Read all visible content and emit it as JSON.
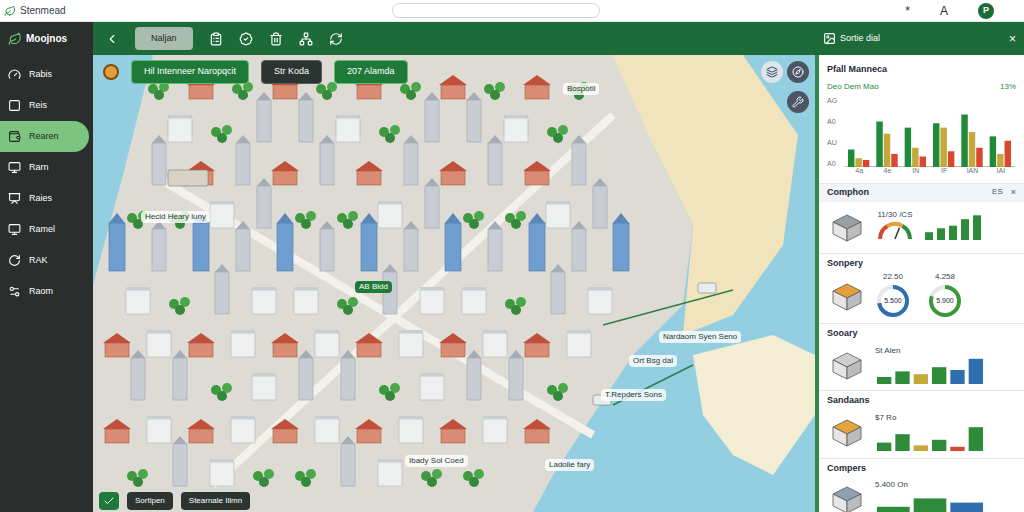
{
  "browser": {
    "title": "Stenmead",
    "actions": [
      "*",
      "A",
      "P"
    ]
  },
  "app": {
    "name": "Moojnos"
  },
  "sidebar": {
    "items": [
      {
        "label": "Rabis",
        "selected": false
      },
      {
        "label": "Reis",
        "selected": false
      },
      {
        "label": "Rearen",
        "selected": true
      },
      {
        "label": "Rarn",
        "selected": false
      },
      {
        "label": "Raies",
        "selected": false
      },
      {
        "label": "Ramel",
        "selected": false
      },
      {
        "label": "RAK",
        "selected": false
      },
      {
        "label": "Raom",
        "selected": false
      }
    ]
  },
  "toolbar": {
    "tabs": [
      {
        "label": "Naljan",
        "selected": true
      }
    ]
  },
  "map": {
    "chips": [
      {
        "label": "Hil Intenneer Naropqcit",
        "active": true
      },
      {
        "label": "Str Koda",
        "active": false
      },
      {
        "label": "207 Alamda",
        "active": true
      }
    ],
    "labels": [
      {
        "text": "Bospotil",
        "kind": "plain"
      },
      {
        "text": "Hecid Heary luny",
        "kind": "plain"
      },
      {
        "text": "AB Bldd",
        "kind": "badge"
      },
      {
        "text": "Nardaom Syen Seno",
        "kind": "plain"
      },
      {
        "text": "Ort Bsg dal",
        "kind": "plain"
      },
      {
        "text": "T.Repders Sons",
        "kind": "plain"
      },
      {
        "text": "Ibady Sol Coed",
        "kind": "plain"
      },
      {
        "text": "Ladolie fary",
        "kind": "plain"
      }
    ],
    "filter": {
      "checked": true,
      "chips": [
        "Sortipen",
        "Stearnale Illmn"
      ]
    }
  },
  "panel": {
    "title": "Sortie dial",
    "close": "×",
    "summary": {
      "title": "Pfall Manneca",
      "subtitle": "Deo Dem Mao",
      "value": "13%",
      "chart": {
        "y_ticks": [
          "AG",
          "A0",
          "AU",
          "A0"
        ],
        "x_labels": [
          "4a",
          "4e",
          "IN",
          "IF",
          "IAN",
          "IAI"
        ],
        "max": 80,
        "series": [
          {
            "color": "#1f8a3a",
            "values": [
              20,
              52,
              45,
              50,
              60,
              35
            ]
          },
          {
            "color": "#c4a93a",
            "values": [
              10,
              38,
              22,
              45,
              40,
              15
            ]
          },
          {
            "color": "#d9472f",
            "values": [
              8,
              15,
              12,
              18,
              22,
              30
            ]
          }
        ]
      }
    },
    "section": {
      "title": "Comphon",
      "badge": "ES",
      "close": "×"
    },
    "cards": [
      {
        "kind": "gauge",
        "label": "",
        "reading": "11/30 /CS",
        "level": 0.62,
        "bars": [
          {
            "value": 30,
            "color": "#2e8b3a"
          },
          {
            "value": 45,
            "color": "#2e8b3a"
          },
          {
            "value": 55,
            "color": "#2e8b3a"
          },
          {
            "value": 80,
            "color": "#2e8b3a"
          },
          {
            "value": 95,
            "color": "#2e8b3a"
          }
        ]
      },
      {
        "kind": "donuts",
        "label": "Sonpery",
        "donuts": [
          {
            "title": "22.50",
            "reading": "5.500",
            "level": 0.72,
            "color": "#2f6fb0"
          },
          {
            "title": "4.258",
            "reading": "5.900",
            "level": 0.8,
            "color": "#3a9a3a"
          }
        ]
      },
      {
        "kind": "bars",
        "label": "Sooary",
        "reading": "St Alen",
        "bars": [
          {
            "value": 25,
            "color": "#2e8b3a"
          },
          {
            "value": 45,
            "color": "#2e8b3a"
          },
          {
            "value": 35,
            "color": "#c4a93a"
          },
          {
            "value": 60,
            "color": "#2e8b3a"
          },
          {
            "value": 50,
            "color": "#2f6fb0"
          },
          {
            "value": 90,
            "color": "#2f6fb0"
          }
        ]
      },
      {
        "kind": "bars",
        "label": "Sandaans",
        "reading": "$7 Ro",
        "bars": [
          {
            "value": 30,
            "color": "#2e8b3a"
          },
          {
            "value": 60,
            "color": "#2e8b3a"
          },
          {
            "value": 20,
            "color": "#c4a93a"
          },
          {
            "value": 40,
            "color": "#2e8b3a"
          },
          {
            "value": 15,
            "color": "#d9472f"
          },
          {
            "value": 85,
            "color": "#2e8b3a"
          }
        ]
      },
      {
        "kind": "bars",
        "label": "Compers",
        "reading": "5.400 On",
        "bars": [
          {
            "value": 40,
            "color": "#2e8b3a"
          },
          {
            "value": 70,
            "color": "#2e8b3a"
          },
          {
            "value": 55,
            "color": "#2f6fb0"
          }
        ]
      }
    ]
  }
}
